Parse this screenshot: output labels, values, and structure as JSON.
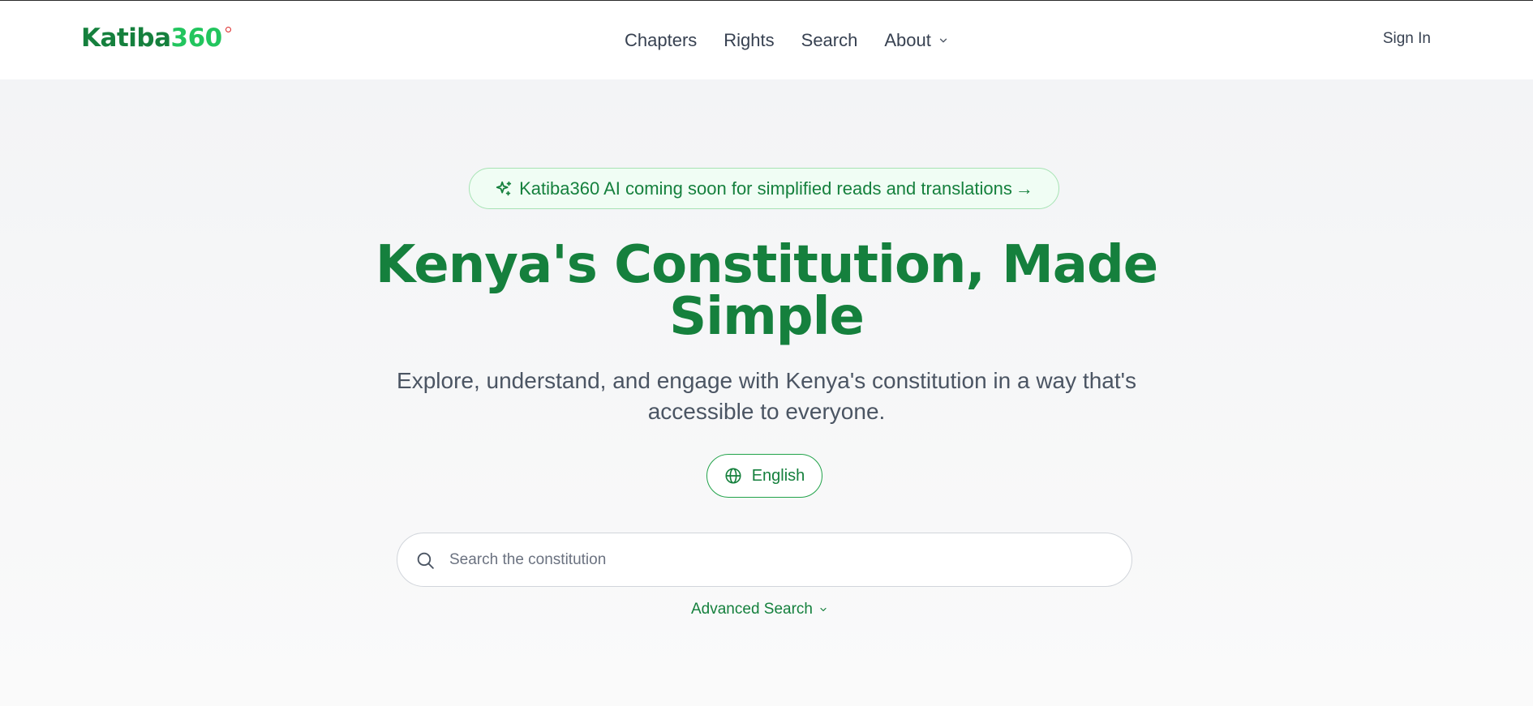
{
  "brand": {
    "name_part1": "Katiba",
    "name_part2": "360",
    "accent": "#15803d",
    "accent_light": "#22c55e",
    "dot_color": "#dc2626"
  },
  "nav": {
    "items": [
      {
        "label": "Chapters"
      },
      {
        "label": "Rights"
      },
      {
        "label": "Search"
      },
      {
        "label": "About",
        "icon": "chevron-down-icon"
      }
    ],
    "signin_label": "Sign In"
  },
  "hero": {
    "announcement": "Katiba360 AI coming soon for simplified reads and translations",
    "announcement_arrow": "→",
    "announcement_icon": "sparkles-icon",
    "title_line1": "Kenya's Constitution, Made",
    "title_line2": "Simple",
    "subtitle_line1": "Explore, understand, and engage with Kenya's constitution in a way that's",
    "subtitle_line2": "accessible to everyone.",
    "language_button": "English",
    "language_icon": "globe-icon"
  },
  "search": {
    "placeholder": "Search the constitution",
    "value": "",
    "icon": "search-icon",
    "advanced_label": "Advanced Search"
  }
}
